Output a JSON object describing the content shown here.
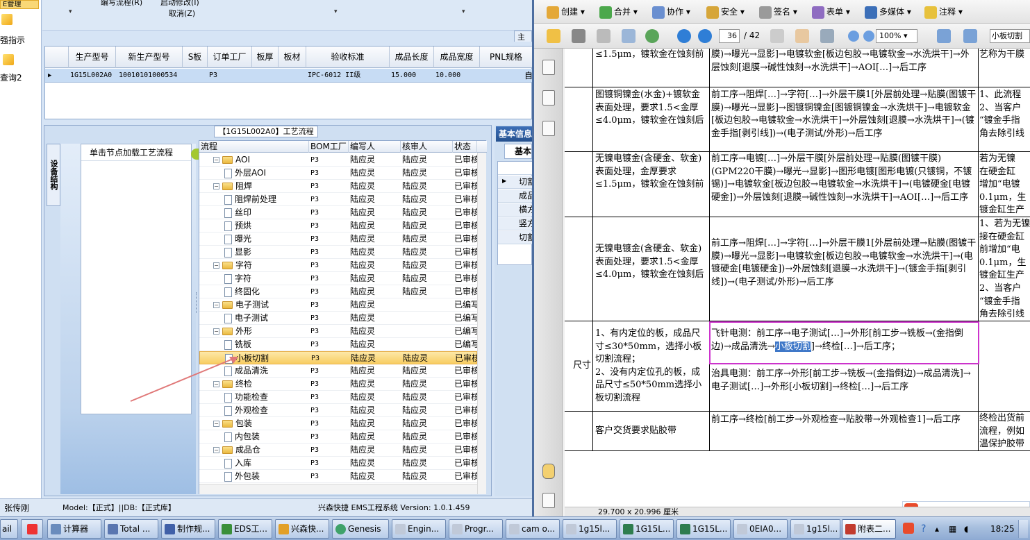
{
  "left_app": {
    "strip": {
      "highlighted_item": "E管理",
      "item1_label": "强指示",
      "item2_label": "查询2"
    },
    "toolbar": {
      "edit_flow": "编写流程(R)",
      "start_edit": "启动修改(I)",
      "cancel": "取消(Z)"
    },
    "tab_label": "主要",
    "product_grid": {
      "columns": [
        "生产型号",
        "新生产型号",
        "S板",
        "订单工厂",
        "板厚",
        "板材",
        "验收标准",
        "成品长度",
        "成品宽度",
        "PNL规格"
      ],
      "row": {
        "model": "1G15L002A0",
        "new_model": "10010101000534",
        "factory": "P3",
        "standard": "IPC-6012 II级",
        "length": "15.000",
        "width": "10.000",
        "tail": "自"
      }
    },
    "process_panel": {
      "title": "【1G15L002A0】工艺流程",
      "side_tab": "设备结构",
      "click_hint": "单击节点加载工艺流程"
    },
    "tree": {
      "columns": [
        "流程",
        "BOM工厂",
        "编写人",
        "核审人",
        "状态"
      ],
      "rows": [
        {
          "level": 1,
          "kind": "folder",
          "name": "AOI",
          "factory": "P3",
          "writer": "陆应灵",
          "reviewer": "陆应灵",
          "status": "已审核"
        },
        {
          "level": 2,
          "kind": "item",
          "name": "外层AOI",
          "factory": "P3",
          "writer": "陆应灵",
          "reviewer": "陆应灵",
          "status": "已审核"
        },
        {
          "level": 1,
          "kind": "folder",
          "name": "阻焊",
          "factory": "P3",
          "writer": "陆应灵",
          "reviewer": "陆应灵",
          "status": "已审核"
        },
        {
          "level": 2,
          "kind": "item",
          "name": "阻焊前处理",
          "factory": "P3",
          "writer": "陆应灵",
          "reviewer": "陆应灵",
          "status": "已审核"
        },
        {
          "level": 2,
          "kind": "item",
          "name": "丝印",
          "factory": "P3",
          "writer": "陆应灵",
          "reviewer": "陆应灵",
          "status": "已审核"
        },
        {
          "level": 2,
          "kind": "item",
          "name": "预烘",
          "factory": "P3",
          "writer": "陆应灵",
          "reviewer": "陆应灵",
          "status": "已审核"
        },
        {
          "level": 2,
          "kind": "item",
          "name": "曝光",
          "factory": "P3",
          "writer": "陆应灵",
          "reviewer": "陆应灵",
          "status": "已审核"
        },
        {
          "level": 2,
          "kind": "item",
          "name": "显影",
          "factory": "P3",
          "writer": "陆应灵",
          "reviewer": "陆应灵",
          "status": "已审核"
        },
        {
          "level": 1,
          "kind": "folder",
          "name": "字符",
          "factory": "P3",
          "writer": "陆应灵",
          "reviewer": "陆应灵",
          "status": "已审核"
        },
        {
          "level": 2,
          "kind": "item",
          "name": "字符",
          "factory": "P3",
          "writer": "陆应灵",
          "reviewer": "陆应灵",
          "status": "已审核"
        },
        {
          "level": 2,
          "kind": "item",
          "name": "终固化",
          "factory": "P3",
          "writer": "陆应灵",
          "reviewer": "陆应灵",
          "status": "已审核"
        },
        {
          "level": 1,
          "kind": "folder",
          "name": "电子测试",
          "factory": "P3",
          "writer": "陆应灵",
          "reviewer": "",
          "status": "已编写"
        },
        {
          "level": 2,
          "kind": "item",
          "name": "电子测试",
          "factory": "P3",
          "writer": "陆应灵",
          "reviewer": "",
          "status": "已编写"
        },
        {
          "level": 1,
          "kind": "folder",
          "name": "外形",
          "factory": "P3",
          "writer": "陆应灵",
          "reviewer": "",
          "status": "已编写"
        },
        {
          "level": 2,
          "kind": "item",
          "name": "铣板",
          "factory": "P3",
          "writer": "陆应灵",
          "reviewer": "",
          "status": "已编写"
        },
        {
          "level": 2,
          "kind": "item",
          "name": "小板切割",
          "factory": "P3",
          "writer": "陆应灵",
          "reviewer": "陆应灵",
          "status": "已审核",
          "selected": true
        },
        {
          "level": 2,
          "kind": "item",
          "name": "成品清洗",
          "factory": "P3",
          "writer": "陆应灵",
          "reviewer": "陆应灵",
          "status": "已审核"
        },
        {
          "level": 1,
          "kind": "folder",
          "name": "终检",
          "factory": "P3",
          "writer": "陆应灵",
          "reviewer": "陆应灵",
          "status": "已审核"
        },
        {
          "level": 2,
          "kind": "item",
          "name": "功能检查",
          "factory": "P3",
          "writer": "陆应灵",
          "reviewer": "陆应灵",
          "status": "已审核"
        },
        {
          "level": 2,
          "kind": "item",
          "name": "外观检查",
          "factory": "P3",
          "writer": "陆应灵",
          "reviewer": "陆应灵",
          "status": "已审核"
        },
        {
          "level": 1,
          "kind": "folder",
          "name": "包装",
          "factory": "P3",
          "writer": "陆应灵",
          "reviewer": "陆应灵",
          "status": "已审核"
        },
        {
          "level": 2,
          "kind": "item",
          "name": "内包装",
          "factory": "P3",
          "writer": "陆应灵",
          "reviewer": "陆应灵",
          "status": "已审核"
        },
        {
          "level": 1,
          "kind": "folder",
          "name": "成品仓",
          "factory": "P3",
          "writer": "陆应灵",
          "reviewer": "陆应灵",
          "status": "已审核"
        },
        {
          "level": 2,
          "kind": "item",
          "name": "入库",
          "factory": "P3",
          "writer": "陆应灵",
          "reviewer": "陆应灵",
          "status": "已审核"
        },
        {
          "level": 2,
          "kind": "item",
          "name": "外包装",
          "factory": "P3",
          "writer": "陆应灵",
          "reviewer": "陆应灵",
          "status": "已审核"
        }
      ]
    },
    "info_panel": {
      "tab": "基本信息",
      "subtab": "基本",
      "rows": [
        "切割",
        "成品",
        "横方",
        "竖方",
        "切割"
      ]
    },
    "status_bar": {
      "user": "张传刚",
      "model": "Model:【正式】||DB:【正式库】",
      "system": "兴森快捷 EMS工程系统 Version: 1.0.1.459"
    }
  },
  "pdf": {
    "toolbar1": [
      "创建",
      "合并",
      "协作",
      "安全",
      "签名",
      "表单",
      "多媒体",
      "注释"
    ],
    "page_current": "36",
    "page_total": "/ 42",
    "zoom": "100%",
    "find_text": "小板切割",
    "page_size": "29.700 x 20.996 厘米",
    "rows": [
      {
        "condition": "≤1.5μm，镀软金在蚀刻前",
        "flow": "膜)→曝光→显影]→电镀软金[板边包胶→电镀软金→水洗烘干]→外层蚀刻[退膜→碱性蚀刻→水洗烘干]→AOI[…]→后工序",
        "note": "艺称为干膜"
      },
      {
        "condition": "图镀铜镍金(水金)+镀软金表面处理，要求1.5<金厚≤4.0μm，镀软金在蚀刻后",
        "flow": "前工序→阻焊[…]→字符[…]→外层干膜1[外层前处理→贴膜(图镀干膜)→曝光→显影]→图镀铜镍金[图镀铜镍金→水洗烘干]→电镀软金[板边包胶→电镀软金→水洗烘干]→外层蚀刻[退膜→水洗烘干]→(镀金手指[剥引线])→(电子测试/外形)→后工序",
        "note": "1、此流程\n2、当客户\n“镀金手指\n角去除引线"
      },
      {
        "condition": "无镍电镀金(含硬金、软金)表面处理，金厚要求≤1.5μm，镀软金在蚀刻前",
        "flow": "前工序→电镀[…]→外层干膜[外层前处理→贴膜(图镀干膜)(GPM220干膜)→曝光→显影]→图形电镀[图形电镀(只镀铜，不镀锡)]→电镀软金[板边包胶→电镀软金→水洗烘干]→(电镀硬金[电镀硬金])→外层蚀刻[退膜→碱性蚀刻→水洗烘干]→AOI[…]→后工序",
        "note": "若为无镍\n在硬金缸\n增加“电镀\n0.1μm，生\n镀金缸生产"
      },
      {
        "condition": "无镍电镀金(含硬金、软金)表面处理，要求1.5<金厚≤4.0μm，镀软金在蚀刻后",
        "flow": "前工序→阻焊[…]→字符[…]→外层干膜1[外层前处理→贴膜(图镀干膜)→曝光→显影]→电镀软金[板边包胶→电镀软金→水洗烘干]→(电镀硬金[电镀硬金])→外层蚀刻[退膜→水洗烘干]→(镀金手指[剥引线])→(电子测试/外形)→后工序",
        "note": "1、若为无镍\n接在硬金缸\n前增加“电\n0.1μm，生\n镀金缸生产\n2、当客户\n“镀金手指\n角去除引线"
      },
      {
        "label": "尺寸",
        "condition": "1、有内定位的板，成品尺寸≤30*50mm，选择小板切割流程；\n2、没有内定位孔的板，成品尺寸≤50*50mm选择小板切割流程",
        "flow_a_pre": "飞针电测：前工序→电子测试[…]→外形[前工步→铣板→(金指倒边)→成品清洗→",
        "flow_a_sel": "小板切割",
        "flow_a_post": "]→终检[…]→后工序；",
        "flow_b": "治具电测：前工序→外形[前工步→铣板→(金指倒边)→成品清洗]→电子测试[…]→外形[小板切割]→终检[…]→后工序",
        "note": ""
      },
      {
        "condition": "客户交货要求贴胶带",
        "flow": "前工序→终检[前工步→外观检查→贴胶带→外观检查1]→后工序",
        "note": "终检出货前\n流程，例如\n温保护胶带"
      }
    ]
  },
  "taskbar": {
    "tasks": [
      "ail",
      "",
      "计算器",
      "Total ...",
      "制作规...",
      "EDS工...",
      "兴森快...",
      "Genesis",
      "Engin...",
      "Progr...",
      "cam o...",
      "1g15l...",
      "1G15L...",
      "1G15L...",
      "0EIA0...",
      "1g15l...",
      "附表二..."
    ],
    "time": "18:25"
  }
}
